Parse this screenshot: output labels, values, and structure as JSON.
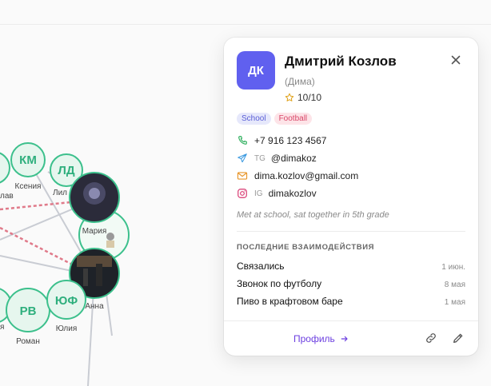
{
  "graph": {
    "nodes": [
      {
        "initials": "КМ",
        "label": "Ксения"
      },
      {
        "initials": "ЛД",
        "label": "Лил"
      },
      {
        "initials": "",
        "label": "лав"
      },
      {
        "initials": "",
        "label": "Мария"
      },
      {
        "initials": "",
        "label": "Анна"
      },
      {
        "initials": "РВ",
        "label": "Роман"
      },
      {
        "initials": "ЮФ",
        "label": "Юлия"
      },
      {
        "initials": "",
        "label": "я"
      }
    ]
  },
  "contact": {
    "avatar_initials": "ДК",
    "name": "Дмитрий Козлов",
    "nickname": "(Дима)",
    "rating": "10/10",
    "tags": [
      {
        "label": "School",
        "color": "#5a5ed6"
      },
      {
        "label": "Football",
        "color": "#d94668"
      }
    ],
    "phone": "+7 916 123 4567",
    "telegram_prefix": "TG",
    "telegram": "@dimakoz",
    "email": "dima.kozlov@gmail.com",
    "instagram_prefix": "IG",
    "instagram": "dimakozlov",
    "note": "Met at school, sat together in 5th grade"
  },
  "interactions": {
    "title": "ПОСЛЕДНИЕ ВЗАИМОДЕЙСТВИЯ",
    "items": [
      {
        "title": "Связались",
        "date": "1 июн."
      },
      {
        "title": "Звонок по футболу",
        "date": "8 мая"
      },
      {
        "title": "Пиво в крафтовом баре",
        "date": "1 мая"
      }
    ]
  },
  "footer": {
    "profile_label": "Профиль"
  },
  "colors": {
    "accent": "#6c3fe0",
    "avatar": "#6060ef",
    "node_green": "#2eaf7d"
  },
  "icons": [
    "close-icon",
    "star-icon",
    "phone-icon",
    "telegram-icon",
    "mail-icon",
    "instagram-icon",
    "arrow-right-icon",
    "link-icon",
    "pencil-icon"
  ]
}
